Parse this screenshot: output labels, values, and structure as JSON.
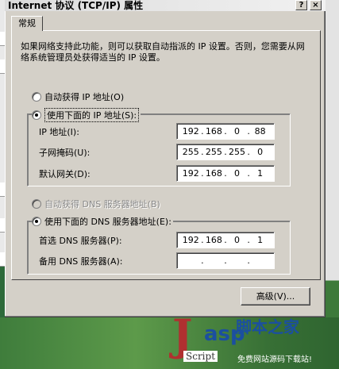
{
  "window": {
    "title": "Internet 协议 (TCP/IP) 属性",
    "help_glyph": "?",
    "close_glyph": "×"
  },
  "tab": {
    "label": "常规"
  },
  "description": "如果网络支持此功能，则可以获取自动指派的 IP 设置。否则，您需要从网络系统管理员处获得适当的 IP 设置。",
  "ip_section": {
    "auto_label": "自动获得 IP 地址(O)",
    "manual_label": "使用下面的 IP 地址(S):",
    "selected": "manual",
    "fields": [
      {
        "label": "IP 地址(I):",
        "octets": [
          "192",
          "168",
          "0",
          "88"
        ]
      },
      {
        "label": "子网掩码(U):",
        "octets": [
          "255",
          "255",
          "255",
          "0"
        ]
      },
      {
        "label": "默认网关(D):",
        "octets": [
          "192",
          "168",
          "0",
          "1"
        ]
      }
    ]
  },
  "dns_section": {
    "auto_label": "自动获得 DNS 服务器地址(B)",
    "manual_label": "使用下面的 DNS 服务器地址(E):",
    "selected": "manual",
    "fields": [
      {
        "label": "首选 DNS 服务器(P):",
        "octets": [
          "192",
          "168",
          "0",
          "1"
        ]
      },
      {
        "label": "备用 DNS 服务器(A):",
        "octets": [
          "",
          "",
          "",
          ""
        ]
      }
    ]
  },
  "advanced_button": "高级(V)...",
  "watermark": {
    "brand": "脚本之家",
    "sub": "Script",
    "tagline": "免费网站源码下载站!"
  }
}
